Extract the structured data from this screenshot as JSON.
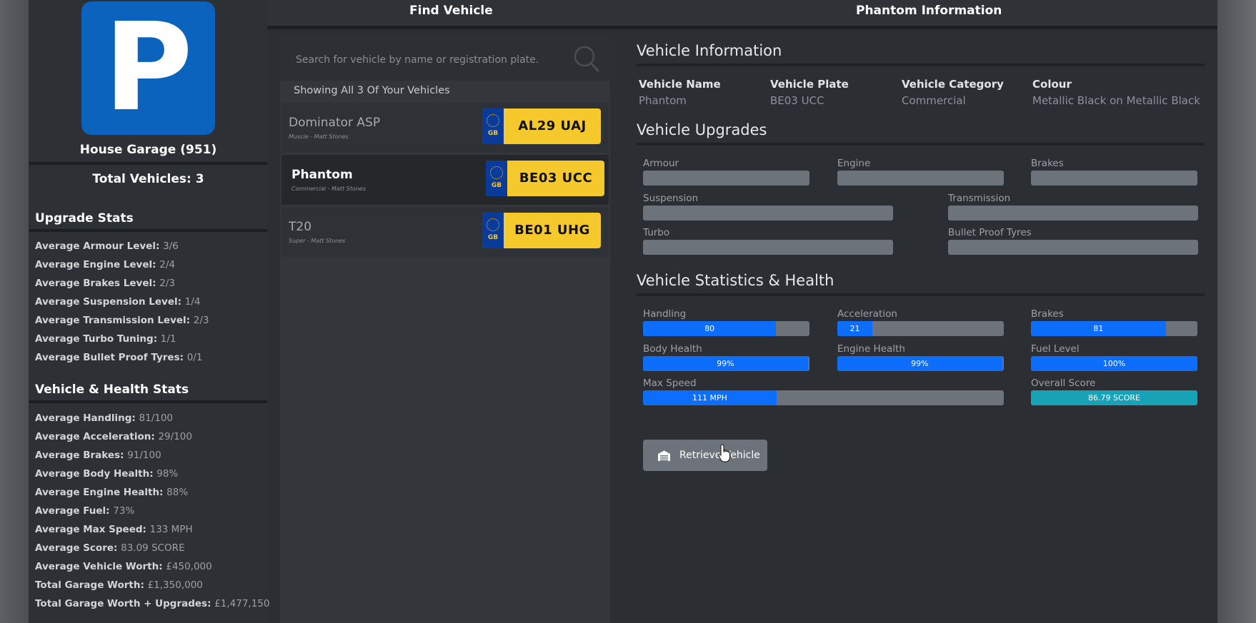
{
  "sidebar": {
    "logo_letter": "P",
    "garage_name": "House Garage (951)",
    "total_vehicles": "Total Vehicles: 3",
    "upgrade_title": "Upgrade Stats",
    "upgrade_stats": [
      {
        "k": "Average Armour Level: ",
        "v": "3/6"
      },
      {
        "k": "Average Engine Level: ",
        "v": "2/4"
      },
      {
        "k": "Average Brakes Level: ",
        "v": "2/3"
      },
      {
        "k": "Average Suspension Level: ",
        "v": "1/4"
      },
      {
        "k": "Average Transmission Level: ",
        "v": "2/3"
      },
      {
        "k": "Average Turbo Tuning: ",
        "v": "1/1"
      },
      {
        "k": "Average Bullet Proof Tyres: ",
        "v": "0/1"
      }
    ],
    "health_title": "Vehicle & Health Stats",
    "health_stats": [
      {
        "k": "Average Handling: ",
        "v": "81/100"
      },
      {
        "k": "Average Acceleration: ",
        "v": "29/100"
      },
      {
        "k": "Average Brakes: ",
        "v": "91/100"
      },
      {
        "k": "Average Body Health: ",
        "v": "98%"
      },
      {
        "k": "Average Engine Health: ",
        "v": "88%"
      },
      {
        "k": "Average Fuel: ",
        "v": "73%"
      },
      {
        "k": "Average Max Speed: ",
        "v": "133 MPH"
      },
      {
        "k": "Average Score: ",
        "v": "83.09 SCORE"
      },
      {
        "k": "Average Vehicle Worth: ",
        "v": "£450,000"
      },
      {
        "k": "Total Garage Worth: ",
        "v": "£1,350,000"
      },
      {
        "k": "Total Garage Worth + Upgrades: ",
        "v": "£1,477,150"
      }
    ]
  },
  "header": {
    "find_title": "Find Vehicle",
    "info_title": "Phantom Information"
  },
  "search": {
    "placeholder": "Search for vehicle by name or registration plate.",
    "value": ""
  },
  "showing_text": "Showing All 3 Of Your Vehicles",
  "vehicles": [
    {
      "name": "Dominator ASP",
      "sub": "Muscle - Matt Stones",
      "plate": "AL29 UAJ",
      "country": "GB",
      "selected": false
    },
    {
      "name": "Phantom",
      "sub": "Commercial - Matt Stones",
      "plate": "BE03 UCC",
      "country": "GB",
      "selected": true
    },
    {
      "name": "T20",
      "sub": "Super - Matt Stones",
      "plate": "BE01 UHG",
      "country": "GB",
      "selected": false
    }
  ],
  "info": {
    "section_info": "Vehicle Information",
    "fields": [
      {
        "label": "Vehicle Name",
        "value": "Phantom"
      },
      {
        "label": "Vehicle Plate",
        "value": "BE03 UCC"
      },
      {
        "label": "Vehicle Category",
        "value": "Commercial"
      },
      {
        "label": "Colour",
        "value": "Metallic Black on Metallic Black"
      }
    ],
    "section_upgrades": "Vehicle Upgrades",
    "upgrades": [
      {
        "label": "Armour",
        "level": 0
      },
      {
        "label": "Engine",
        "level": 0
      },
      {
        "label": "Brakes",
        "level": 0
      },
      {
        "label": "Suspension",
        "level": 0
      },
      {
        "label": "Transmission",
        "level": 0
      },
      {
        "label": "Turbo",
        "level": 0
      },
      {
        "label": "Bullet Proof Tyres",
        "level": 0
      }
    ],
    "section_stats": "Vehicle Statistics & Health",
    "stats": [
      {
        "label": "Handling",
        "text": "80",
        "fill": 0.8
      },
      {
        "label": "Acceleration",
        "text": "21",
        "fill": 0.21
      },
      {
        "label": "Brakes",
        "text": "81",
        "fill": 0.81
      },
      {
        "label": "Body Health",
        "text": "99%",
        "fill": 0.99
      },
      {
        "label": "Engine Health",
        "text": "99%",
        "fill": 0.99
      },
      {
        "label": "Fuel Level",
        "text": "100%",
        "fill": 1.0
      },
      {
        "label": "Max Speed",
        "text": "111 MPH",
        "fill": 0.37
      },
      {
        "label": "Overall Score",
        "text": "86.79 SCORE",
        "fill": 1.0
      }
    ],
    "retrieve_label": "Retrieve Vehicle"
  },
  "colors": {
    "accent_blue": "#0d6efd",
    "score_teal": "#17a2b8",
    "plate_yellow": "#f5c92c",
    "logo_blue": "#0b63bd"
  }
}
